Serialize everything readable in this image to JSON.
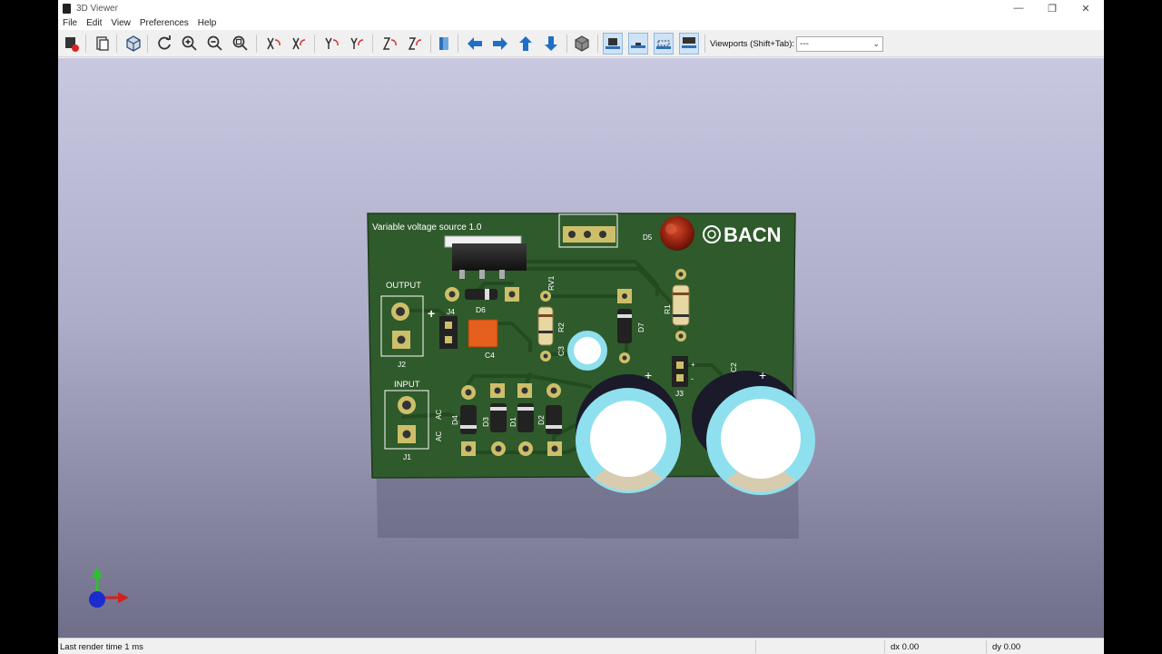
{
  "window": {
    "title": "3D Viewer",
    "minimize": "—",
    "restore": "❐",
    "close": "✕"
  },
  "menu": [
    "File",
    "Edit",
    "View",
    "Preferences",
    "Help"
  ],
  "toolbar": {
    "viewports_label": "Viewports (Shift+Tab):",
    "viewports_value": "---",
    "caret": "⌄"
  },
  "board": {
    "title": "Variable voltage source 1.0",
    "logo": "BACN",
    "labels": {
      "output": "OUTPUT",
      "input": "INPUT",
      "j1": "J1",
      "j2": "J2",
      "j3": "J3",
      "j4": "J4",
      "d1": "D1",
      "d2": "D2",
      "d3": "D3",
      "d4": "D4",
      "d5": "D5",
      "d6": "D6",
      "d7": "D7",
      "r1": "R1",
      "r2": "R2",
      "rv1": "RV1",
      "c2": "C2",
      "c3": "C3",
      "c4": "C4",
      "ac1": "AC",
      "ac2": "AC",
      "plus": "+",
      "minus": "-"
    }
  },
  "colors": {
    "pcb": "#2f5a2b",
    "silk": "#ffffff",
    "pad": "#cdbf6a",
    "cap": "#8ee0ee"
  },
  "status": {
    "render": "Last render time 1 ms",
    "dx": "dx 0.00",
    "dy": "dy 0.00"
  }
}
